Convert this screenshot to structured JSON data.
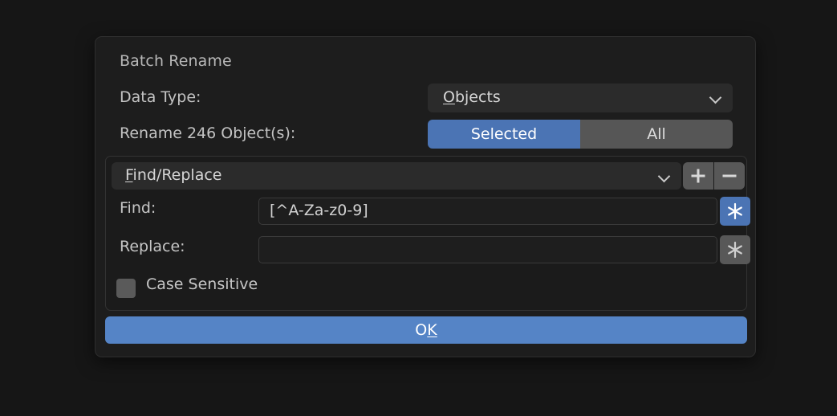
{
  "dialog": {
    "title": "Batch Rename",
    "data_type": {
      "label": "Data Type:",
      "value": "Objects",
      "accel": "O",
      "chevron_icon": "chevron-down-icon"
    },
    "rename_scope": {
      "label": "Rename 246 Object(s):",
      "count": 246,
      "options": [
        "Selected",
        "All"
      ],
      "selected": "Selected"
    },
    "find_replace": {
      "header": "Find/Replace",
      "header_accel": "F",
      "add_icon": "plus-icon",
      "remove_icon": "minus-icon",
      "chevron_icon": "chevron-down-icon",
      "find": {
        "label": "Find:",
        "value": "[^A-Za-z0-9]",
        "regex_icon": "asterisk-icon",
        "regex_enabled": true
      },
      "replace": {
        "label": "Replace:",
        "value": "",
        "regex_icon": "asterisk-icon",
        "regex_enabled": false
      },
      "case_sensitive": {
        "label": "Case Sensitive",
        "checked": false
      }
    },
    "confirm": {
      "label": "OK",
      "accel": "K"
    }
  },
  "colors": {
    "accent": "#4B74B4",
    "accent_button": "#5584C6",
    "panel": "#1D1D1D",
    "subpanel": "#1B1B1B",
    "background": "#161616",
    "field": "#1E1E1E",
    "control": "#2B2B2B",
    "toggle_off": "#565656",
    "text": "#C6C6C6"
  }
}
